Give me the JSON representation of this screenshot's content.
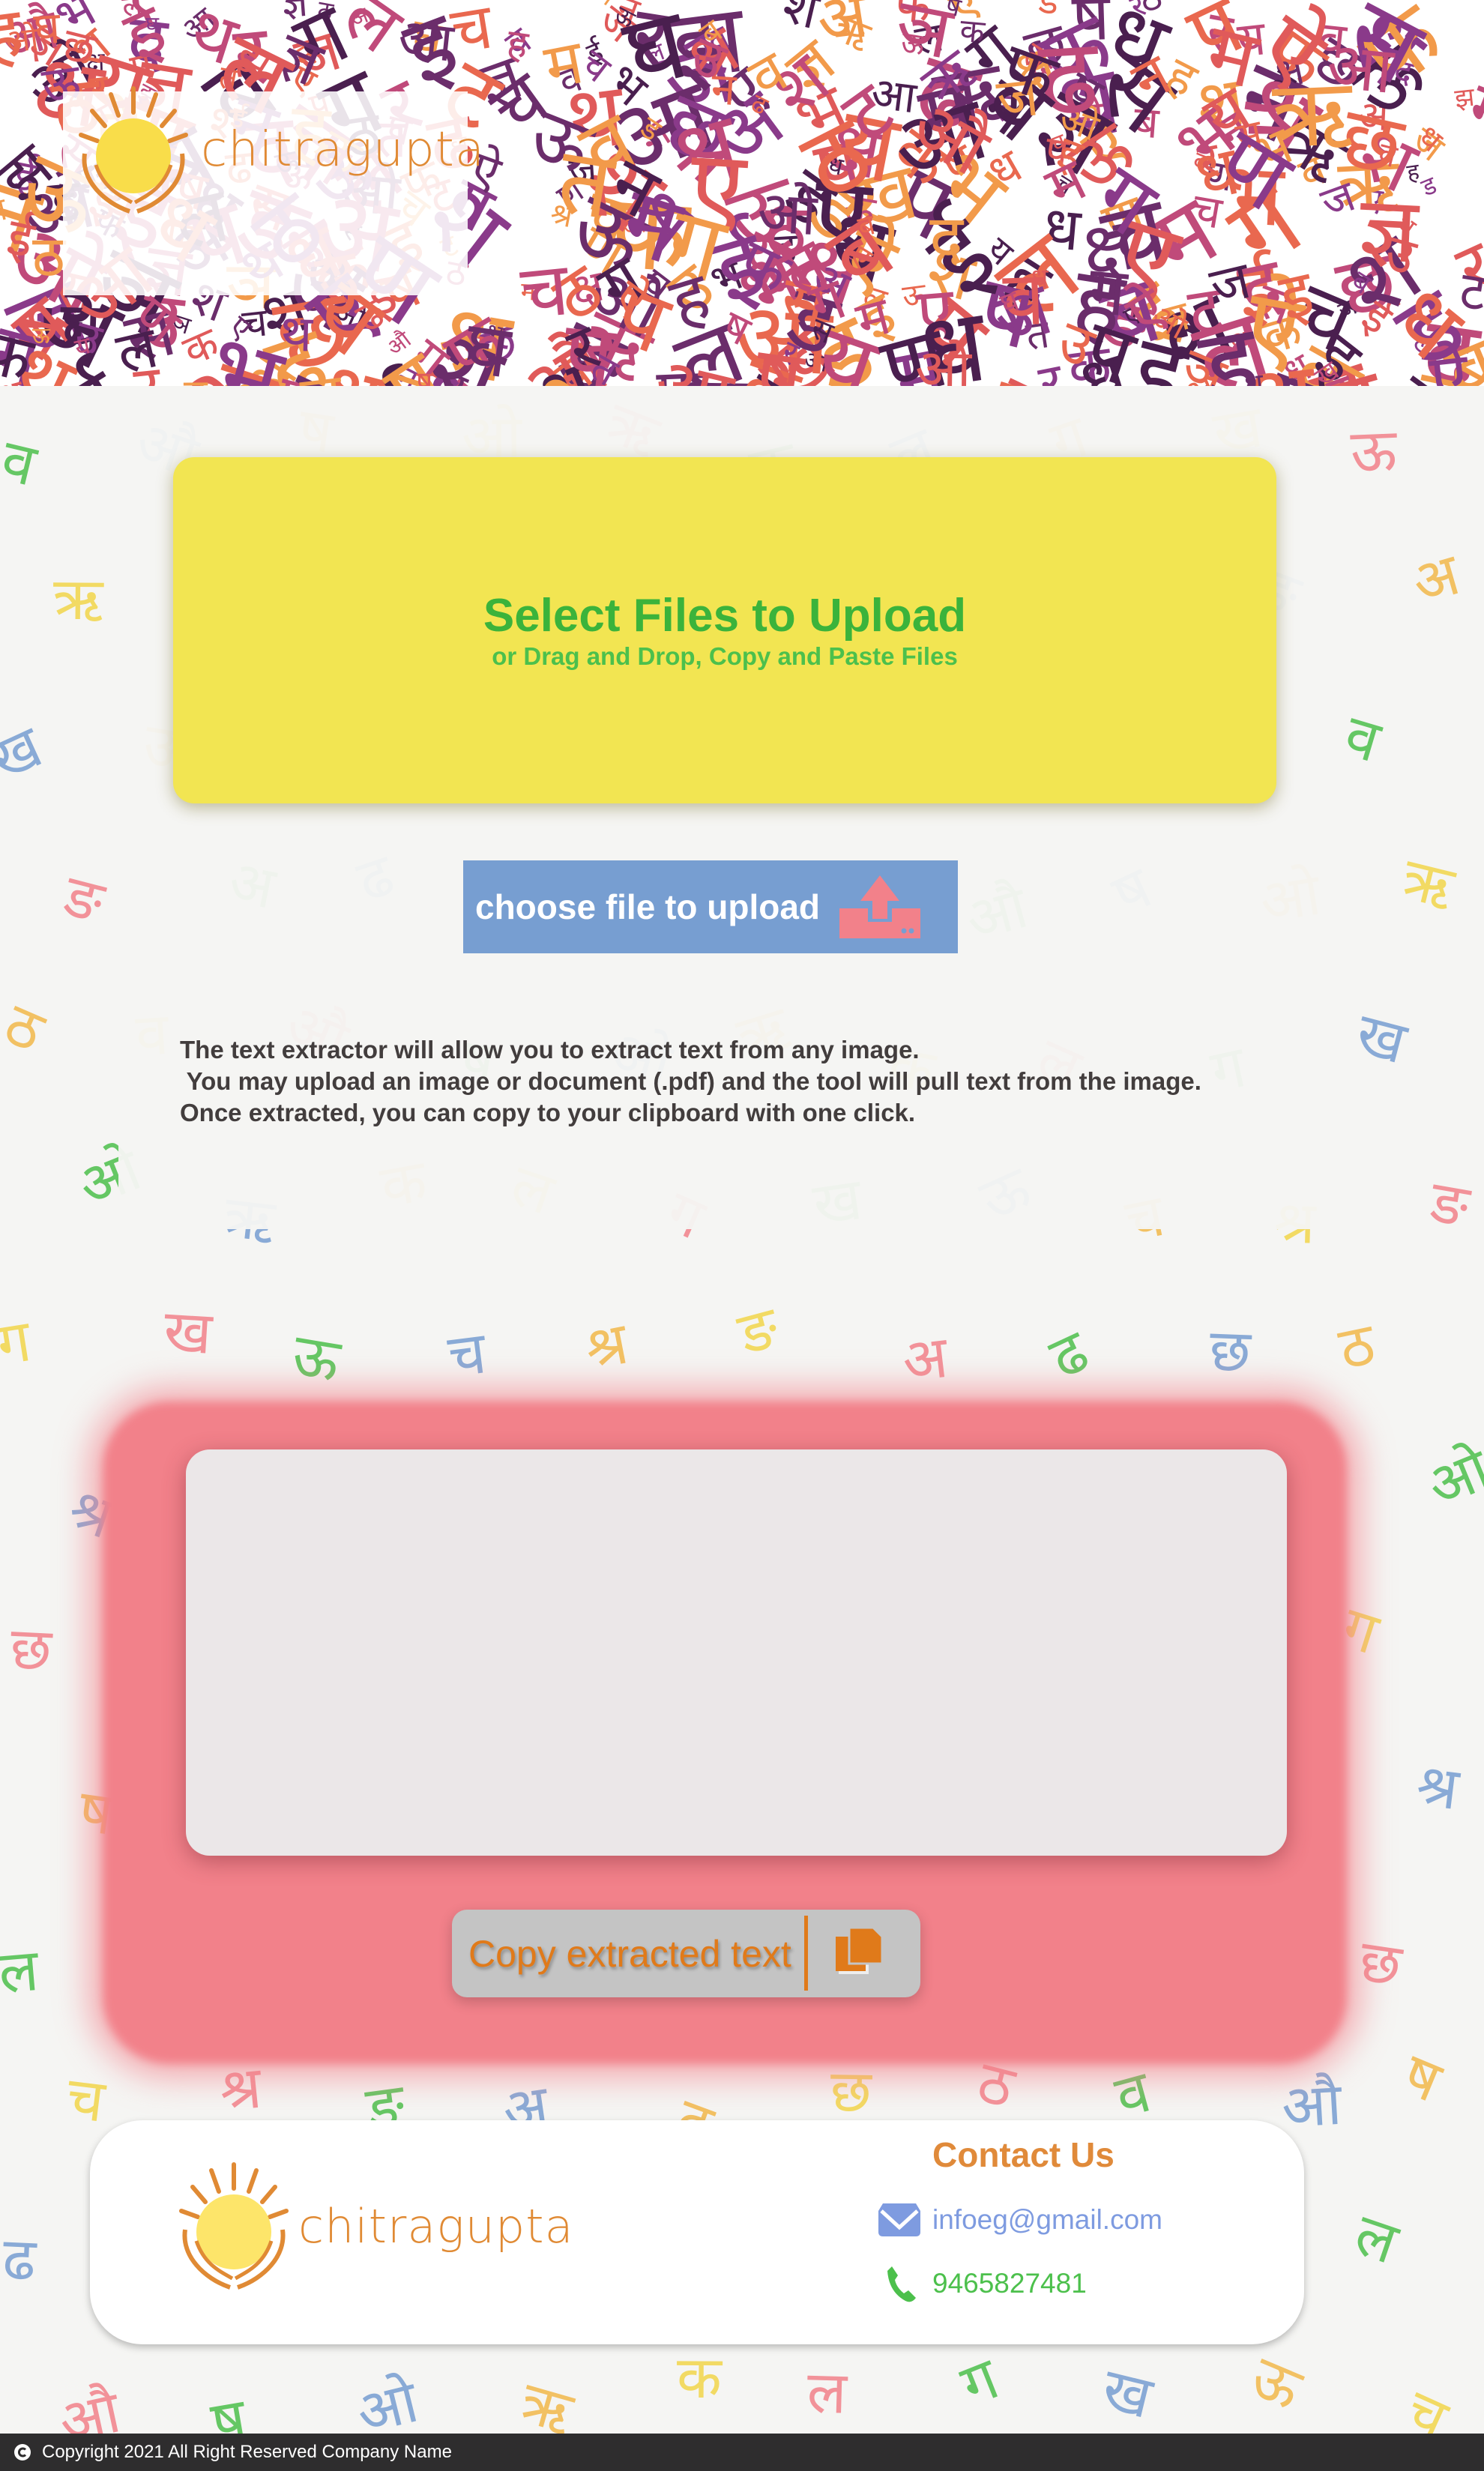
{
  "brand": {
    "name": "chitragupta"
  },
  "banner": {
    "glyphs": [
      "अ",
      "आ",
      "इ",
      "ई",
      "उ",
      "ऊ",
      "ऋ",
      "ए",
      "ऐ",
      "ओ",
      "औ",
      "क",
      "ख",
      "ग",
      "घ",
      "ङ",
      "च",
      "छ",
      "ज",
      "झ",
      "ञ",
      "ट",
      "ठ",
      "ड",
      "ढ",
      "ण",
      "त",
      "थ",
      "द",
      "ध",
      "न",
      "प",
      "फ",
      "ब",
      "भ",
      "म",
      "य",
      "र",
      "ल",
      "व",
      "श",
      "ष",
      "स",
      "ह",
      "क्ष",
      "श्र",
      "ज्ञ"
    ],
    "colors": [
      "#6b2d6b",
      "#8a3a8a",
      "#e9684f",
      "#f29a4a",
      "#c04a7a",
      "#e05a5a",
      "#4a1f4f"
    ]
  },
  "background": {
    "glyphs": [
      "व",
      "ग",
      "ढ",
      "ऋ",
      "श्र",
      "औ",
      "ख",
      "छ",
      "क",
      "ङ",
      "ष",
      "ऊ",
      "ठ",
      "ल",
      "अ",
      "ओ",
      "च"
    ],
    "colors": [
      "#4cc04c",
      "#f2d64a",
      "#779ed1",
      "#f2818a",
      "#f2b84a"
    ]
  },
  "upload": {
    "title": "Select Files to Upload",
    "subtitle": "or Drag and Drop, Copy and Paste Files",
    "choose_label": "choose file to upload"
  },
  "description": "The text extractor will allow you to extract text from any image.\n You may upload an image or document (.pdf) and the tool will pull text from the image.\nOnce extracted, you can copy to your clipboard with one click.",
  "output": {
    "text": "",
    "copy_label": "Copy extracted text"
  },
  "footer": {
    "contact_title": "Contact Us",
    "email": "infoeg@gmail.com",
    "phone": "9465827481",
    "copyright": "Copyright 2021 All Right Reserved Company Name"
  },
  "colors": {
    "green": "#3bb33b",
    "yellow": "#f2e552",
    "blue": "#779ed1",
    "pink": "#f2818a",
    "orange": "#e07a1a"
  }
}
